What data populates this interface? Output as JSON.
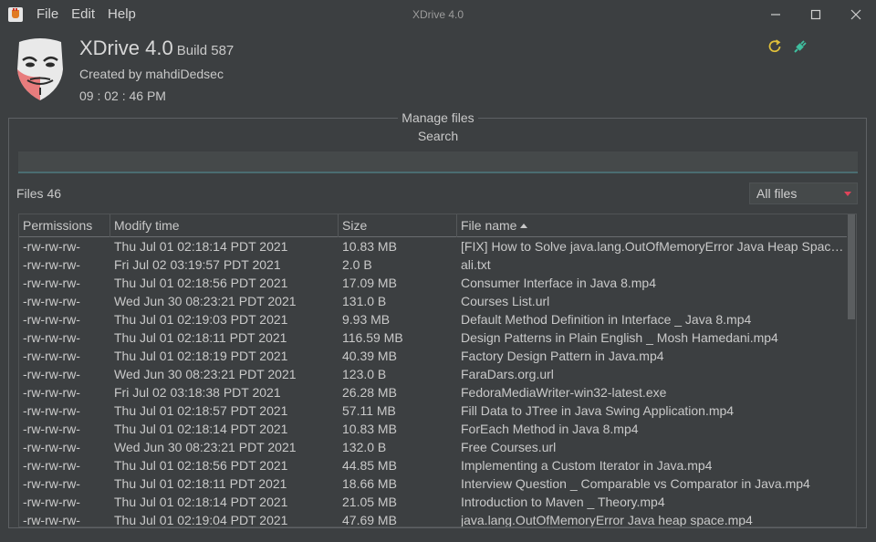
{
  "menu": [
    "File",
    "Edit",
    "Help"
  ],
  "window_title": "XDrive 4.0",
  "header": {
    "app_name": "XDrive 4.0",
    "build": "Build 587",
    "created_by": "Created by mahdiDedsec",
    "clock": "09 : 02 : 46 PM"
  },
  "panel": {
    "title": "Manage files",
    "search_label": "Search",
    "search_value": "",
    "files_count": "Files 46",
    "filter_selected": "All files"
  },
  "table": {
    "columns": [
      "Permissions",
      "Modify time",
      "Size",
      "File name"
    ],
    "rows": [
      [
        "-rw-rw-rw-",
        "Thu Jul 01 02:18:14 PDT 2021",
        "10.83 MB",
        "[FIX] How to Solve java.lang.OutOfMemoryError Java Heap Space..."
      ],
      [
        "-rw-rw-rw-",
        "Fri Jul 02 03:19:57 PDT 2021",
        "2.0 B",
        "ali.txt"
      ],
      [
        "-rw-rw-rw-",
        "Thu Jul 01 02:18:56 PDT 2021",
        "17.09 MB",
        "Consumer Interface in Java 8.mp4"
      ],
      [
        "-rw-rw-rw-",
        "Wed Jun 30 08:23:21 PDT 2021",
        "131.0 B",
        "Courses List.url"
      ],
      [
        "-rw-rw-rw-",
        "Thu Jul 01 02:19:03 PDT 2021",
        "9.93 MB",
        "Default Method Definition in Interface _ Java 8.mp4"
      ],
      [
        "-rw-rw-rw-",
        "Thu Jul 01 02:18:11 PDT 2021",
        "116.59 MB",
        "Design Patterns in Plain English _ Mosh Hamedani.mp4"
      ],
      [
        "-rw-rw-rw-",
        "Thu Jul 01 02:18:19 PDT 2021",
        "40.39 MB",
        "Factory Design Pattern in Java.mp4"
      ],
      [
        "-rw-rw-rw-",
        "Wed Jun 30 08:23:21 PDT 2021",
        "123.0 B",
        "FaraDars.org.url"
      ],
      [
        "-rw-rw-rw-",
        "Fri Jul 02 03:18:38 PDT 2021",
        "26.28 MB",
        "FedoraMediaWriter-win32-latest.exe"
      ],
      [
        "-rw-rw-rw-",
        "Thu Jul 01 02:18:57 PDT 2021",
        "57.11 MB",
        "Fill Data to JTree in Java Swing Application.mp4"
      ],
      [
        "-rw-rw-rw-",
        "Thu Jul 01 02:18:14 PDT 2021",
        "10.83 MB",
        "ForEach Method in Java 8.mp4"
      ],
      [
        "-rw-rw-rw-",
        "Wed Jun 30 08:23:21 PDT 2021",
        "132.0 B",
        "Free Courses.url"
      ],
      [
        "-rw-rw-rw-",
        "Thu Jul 01 02:18:56 PDT 2021",
        "44.85 MB",
        "Implementing a Custom Iterator in Java.mp4"
      ],
      [
        "-rw-rw-rw-",
        "Thu Jul 01 02:18:11 PDT 2021",
        "18.66 MB",
        "Interview Question _ Comparable vs Comparator in Java.mp4"
      ],
      [
        "-rw-rw-rw-",
        "Thu Jul 01 02:18:14 PDT 2021",
        "21.05 MB",
        "Introduction to Maven _ Theory.mp4"
      ],
      [
        "-rw-rw-rw-",
        "Thu Jul 01 02:19:04 PDT 2021",
        "47.69 MB",
        "java.lang.OutOfMemoryError  Java heap space.mp4"
      ]
    ]
  },
  "colors": {
    "background": "#3c3f41",
    "accent_refresh": "#e0c03a",
    "accent_plug": "#3fbf9f",
    "filter_arrow": "#e0445a"
  },
  "icons": {
    "app": "java-cup-icon",
    "avatar": "guy-fawkes-mask-icon",
    "refresh": "refresh-icon",
    "connect": "plug-icon"
  }
}
